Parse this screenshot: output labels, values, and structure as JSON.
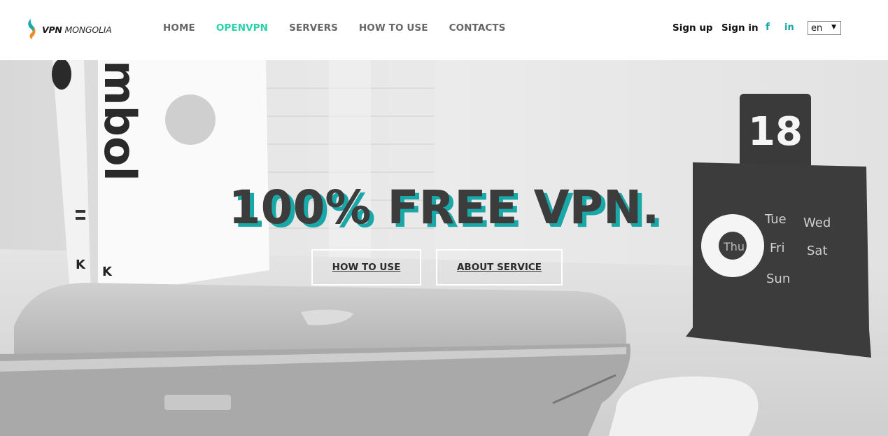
{
  "brand": {
    "bold": "VPN",
    "rest": "MONGOLIA",
    "colors": {
      "teal": "#1aa7a8",
      "orange": "#f08a24"
    }
  },
  "nav": {
    "items": [
      {
        "label": "HOME",
        "active": false
      },
      {
        "label": "OPENVPN",
        "active": true
      },
      {
        "label": "SERVERS",
        "active": false
      },
      {
        "label": "HOW TO USE",
        "active": false
      },
      {
        "label": "CONTACTS",
        "active": false
      }
    ],
    "active_color": "#2ad0a8"
  },
  "auth": {
    "signup": "Sign up",
    "signin": "Sign in"
  },
  "social": {
    "facebook": "f",
    "linkedin": "in",
    "icons": [
      "facebook-icon",
      "linkedin-icon"
    ]
  },
  "language": {
    "selected": "en",
    "arrow": "▼"
  },
  "hero": {
    "headline": "100% FREE VPN.",
    "buttons": {
      "how_to_use": "HOW TO USE",
      "about_service": "ABOUT SERVICE"
    },
    "book_spine": "mbol",
    "calendar": {
      "date": "18",
      "days": [
        "Tue",
        "Wed",
        "Thu",
        "Fri",
        "Sat",
        "Sun"
      ]
    },
    "shadow_color": "#1aa7a8"
  }
}
